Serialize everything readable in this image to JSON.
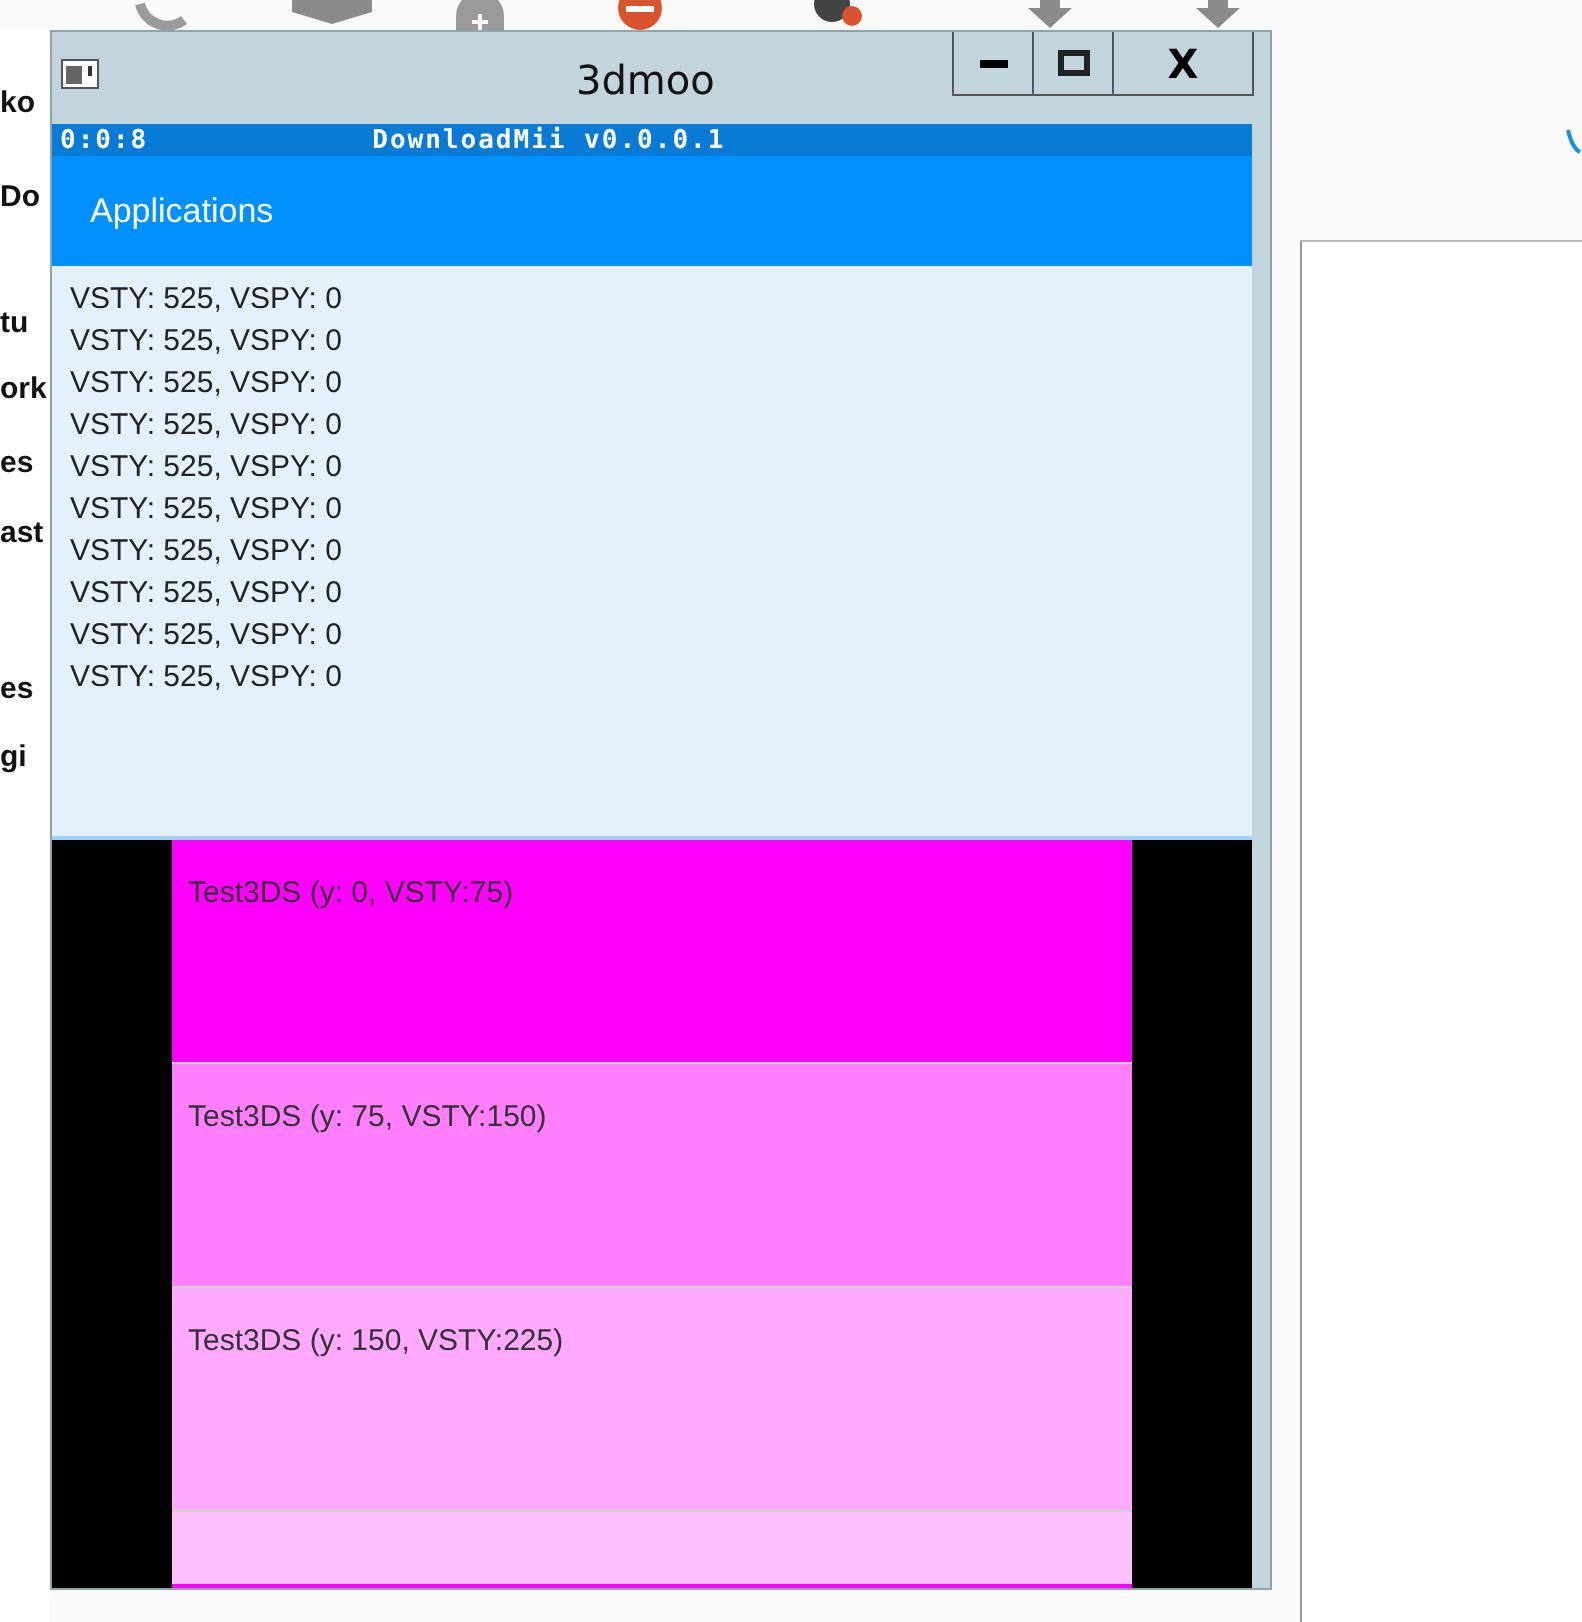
{
  "background_app": {
    "side_texts": [
      "ko",
      "Do",
      "tu",
      "ork",
      "es",
      "ast",
      "es",
      "gi"
    ]
  },
  "window": {
    "title": "3dmoo",
    "controls": [
      {
        "kind": "minimize"
      },
      {
        "kind": "maximize"
      },
      {
        "kind": "close",
        "label": "X"
      }
    ]
  },
  "top_screen": {
    "status_bar": {
      "time": "0:0:8",
      "title": "DownloadMii v0.0.0.1"
    },
    "app_bar": {
      "title": "Applications"
    },
    "log_lines": [
      "VSTY: 525, VSPY: 0",
      "VSTY: 525, VSPY: 0",
      "VSTY: 525, VSPY: 0",
      "VSTY: 525, VSPY: 0",
      "VSTY: 525, VSPY: 0",
      "VSTY: 525, VSPY: 0",
      "VSTY: 525, VSPY: 0",
      "VSTY: 525, VSPY: 0",
      "VSTY: 525, VSPY: 0",
      "VSTY: 525, VSPY: 0"
    ]
  },
  "bottom_screen": {
    "rows": [
      {
        "label": "Test3DS (y: 0, VSTY:75)",
        "color": "#ff00ff"
      },
      {
        "label": "Test3DS (y: 75, VSTY:150)",
        "color": "#ff7fff"
      },
      {
        "label": "Test3DS (y: 150, VSTY:225)",
        "color": "#ffaaff"
      },
      {
        "color": "#ffc0ff"
      }
    ]
  }
}
